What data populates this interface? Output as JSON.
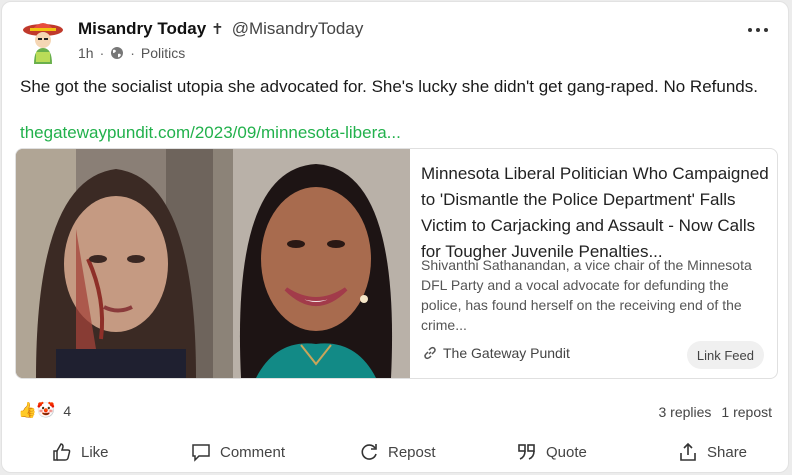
{
  "author": {
    "name": "Misandry Today",
    "mark": "✝",
    "handle": "@MisandryToday"
  },
  "meta": {
    "time": "1h",
    "separator": "·",
    "visibility_icon": "globe-icon",
    "category": "Politics"
  },
  "post": {
    "text": "She got the socialist utopia she advocated for. She's lucky she didn't get gang-raped. No Refunds.",
    "link_text": "thegatewaypundit.com/2023/09/minnesota-libera..."
  },
  "link_preview": {
    "title": "Minnesota Liberal Politician Who Campaigned to 'Dismantle the Police Department' Falls Victim to Carjacking and Assault - Now Calls for Tougher Juvenile Penalties...",
    "description": "Shivanthi Sathanandan, a vice chair of the Minnesota DFL Party and a vocal advocate for defunding the police, has found herself on the receiving end of the crime...",
    "source": "The Gateway Pundit",
    "badge": "Link Feed"
  },
  "reactions": {
    "emojis": "👍🤡",
    "count": "4"
  },
  "stats": {
    "replies": "3 replies",
    "reposts": "1 repost"
  },
  "actions": {
    "like": "Like",
    "comment": "Comment",
    "repost": "Repost",
    "quote": "Quote",
    "share": "Share"
  },
  "colors": {
    "link": "#22b14c",
    "text": "#1a1a1a",
    "muted": "#555555",
    "card_bg": "#ffffff",
    "page_bg": "#ececec"
  }
}
